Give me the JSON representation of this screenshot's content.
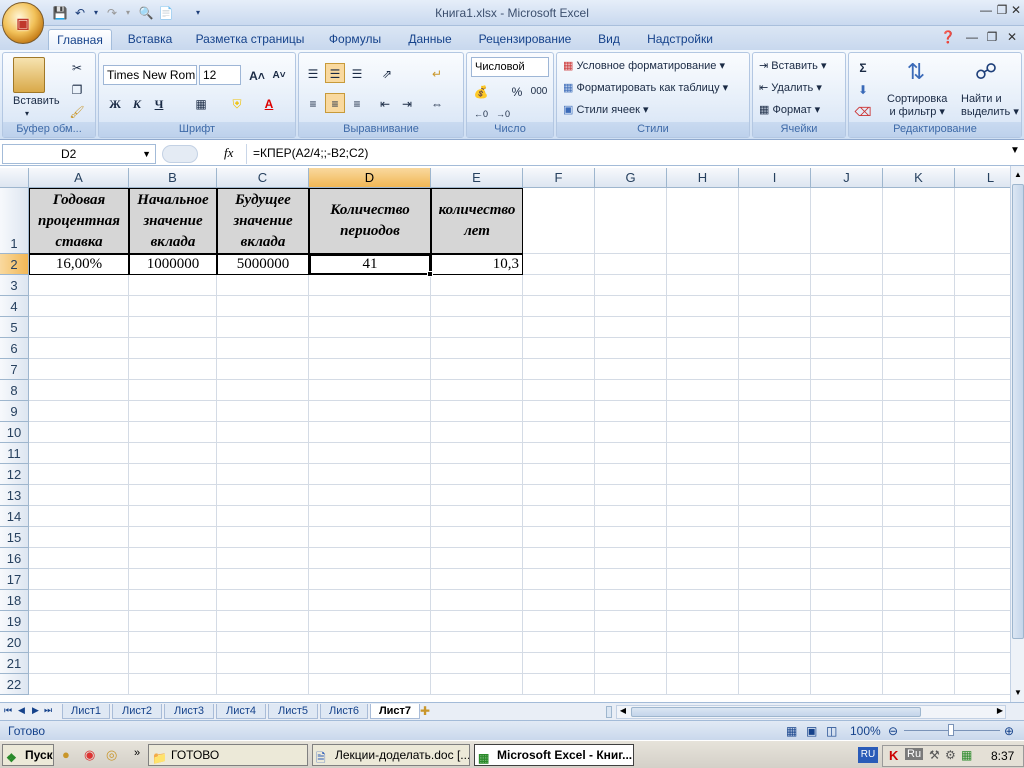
{
  "window": {
    "title": "Книга1.xlsx - Microsoft Excel"
  },
  "ribbon_tabs": [
    "Главная",
    "Вставка",
    "Разметка страницы",
    "Формулы",
    "Данные",
    "Рецензирование",
    "Вид",
    "Надстройки"
  ],
  "active_tab": "Главная",
  "ribbon": {
    "clipboard": {
      "paste": "Вставить",
      "label": "Буфер обм..."
    },
    "font": {
      "name": "Times New Rom",
      "size": "12",
      "bold": "Ж",
      "italic": "К",
      "underline": "Ч",
      "grow": "A˄",
      "shrink": "A˅",
      "color_letter": "A",
      "label": "Шрифт"
    },
    "alignment": {
      "label": "Выравнивание"
    },
    "number": {
      "format": "Числовой",
      "percent": "%",
      "thousands": "000",
      "label": "Число"
    },
    "styles": {
      "conditional": "Условное форматирование",
      "as_table": "Форматировать как таблицу",
      "cell_styles": "Стили ячеек",
      "label": "Стили"
    },
    "cells": {
      "insert": "Вставить",
      "delete": "Удалить",
      "format": "Формат",
      "label": "Ячейки"
    },
    "editing": {
      "sigma": "Σ",
      "sort_1": "Сортировка",
      "sort_2": "и фильтр",
      "find_1": "Найти и",
      "find_2": "выделить",
      "label": "Редактирование"
    }
  },
  "formula_bar": {
    "name_box": "D2",
    "fx": "fx",
    "formula": "=КПЕР(A2/4;;-B2;C2)"
  },
  "columns": [
    "A",
    "B",
    "C",
    "D",
    "E",
    "F",
    "G",
    "H",
    "I",
    "J",
    "K",
    "L"
  ],
  "selected_column": "D",
  "rows": [
    "1",
    "2",
    "3",
    "4",
    "5",
    "6",
    "7",
    "8",
    "9",
    "10",
    "11",
    "12",
    "13",
    "14",
    "15",
    "16",
    "17",
    "18",
    "19",
    "20",
    "21",
    "22"
  ],
  "headers": {
    "A": [
      "Годовая",
      "процентная",
      "ставка"
    ],
    "B": [
      "Начальное",
      "значение",
      "вклада"
    ],
    "C": [
      "Будущее",
      "значение",
      "вклада"
    ],
    "D": [
      "Количество",
      "периодов"
    ],
    "E": [
      "количество",
      "лет"
    ]
  },
  "values": {
    "A2": "16,00%",
    "B2": "1000000",
    "C2": "5000000",
    "D2": "41",
    "E2": "10,3"
  },
  "sheets": [
    "Лист1",
    "Лист2",
    "Лист3",
    "Лист4",
    "Лист5",
    "Лист6",
    "Лист7"
  ],
  "active_sheet": "Лист7",
  "status": {
    "ready": "Готово",
    "zoom": "100%"
  },
  "taskbar": {
    "start": "Пуск",
    "buttons": [
      "ГОТОВО",
      "Лекции-доделать.doc [...",
      "Microsoft Excel - Книг..."
    ],
    "lang": "RU",
    "tray_lang": "Ru",
    "clock": "8:37"
  },
  "colors": {
    "accent": "#15428b",
    "header_fill": "#d6d6d6",
    "selected_header": "#f1b755"
  }
}
